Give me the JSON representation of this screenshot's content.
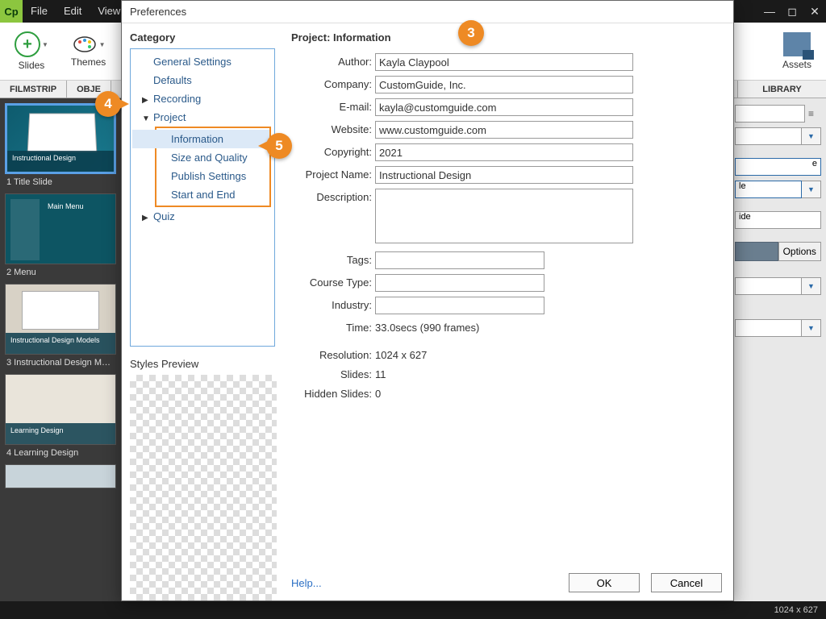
{
  "app": {
    "logo_text": "Cp"
  },
  "menu": {
    "file": "File",
    "edit": "Edit",
    "view": "View"
  },
  "window_controls": {
    "min": "—",
    "max": "◻",
    "close": "✕"
  },
  "toolbar": {
    "slides": "Slides",
    "themes": "Themes",
    "assets": "Assets"
  },
  "subtabs": {
    "filmstrip": "FILMSTRIP",
    "objects": "OBJE",
    "library": "LIBRARY"
  },
  "filmstrip": {
    "slides": [
      {
        "caption": "Instructional Design",
        "label": "1 Title Slide"
      },
      {
        "caption": "Main Menu",
        "label": "2 Menu"
      },
      {
        "caption": "Instructional Design Models",
        "label": "3 Instructional Design M…"
      },
      {
        "caption": "Learning Design",
        "label": "4 Learning Design"
      }
    ]
  },
  "right_panel": {
    "guide_txt": "ide",
    "options": "Options"
  },
  "statusbar": {
    "resolution": "1024 x 627"
  },
  "dialog": {
    "title": "Preferences",
    "category_label": "Category",
    "tree": {
      "general": "General Settings",
      "defaults": "Defaults",
      "recording": "Recording",
      "project": "Project",
      "information": "Information",
      "size_quality": "Size and Quality",
      "publish": "Publish Settings",
      "start_end": "Start and End",
      "quiz": "Quiz"
    },
    "styles_preview": "Styles Preview",
    "panel_title": "Project: Information",
    "fields": {
      "author_label": "Author:",
      "author": "Kayla Claypool",
      "company_label": "Company:",
      "company": "CustomGuide, Inc.",
      "email_label": "E-mail:",
      "email": "kayla@customguide.com",
      "website_label": "Website:",
      "website": "www.customguide.com",
      "copyright_label": "Copyright:",
      "copyright": "2021",
      "project_name_label": "Project Name:",
      "project_name": "Instructional Design",
      "description_label": "Description:",
      "description": "",
      "tags_label": "Tags:",
      "tags": "",
      "course_type_label": "Course Type:",
      "course_type": "",
      "industry_label": "Industry:",
      "industry": "",
      "time_label": "Time:",
      "time": "33.0secs (990 frames)",
      "resolution_label": "Resolution:",
      "resolution": "1024 x 627",
      "slides_label": "Slides:",
      "slides": "11",
      "hidden_label": "Hidden Slides:",
      "hidden": "0"
    },
    "help": "Help...",
    "ok": "OK",
    "cancel": "Cancel"
  },
  "callouts": {
    "c3": "3",
    "c4": "4",
    "c5": "5"
  }
}
